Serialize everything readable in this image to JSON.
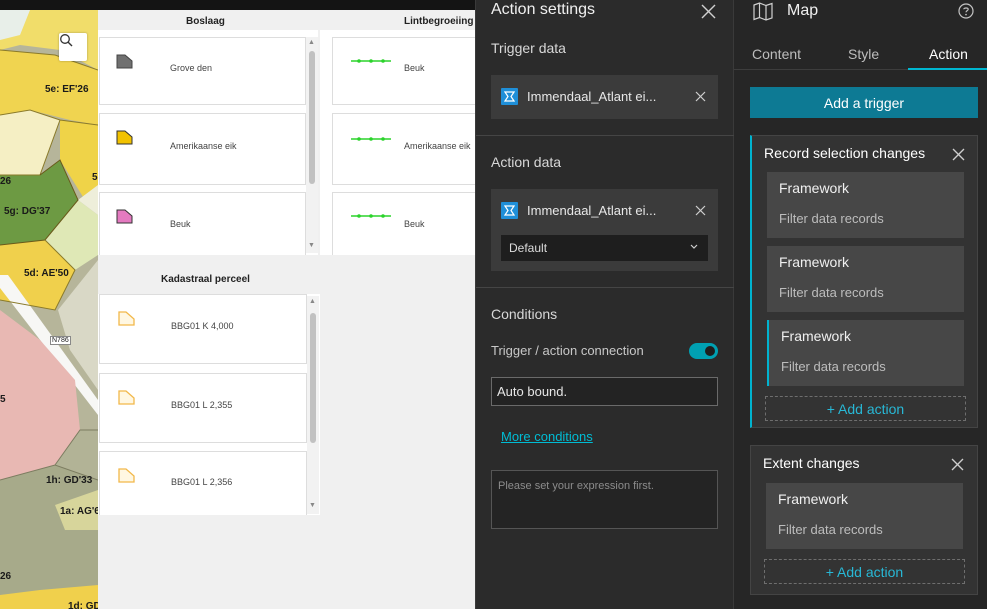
{
  "colors": {
    "accent": "#00a0b2",
    "link": "#00bcd4",
    "primary_button": "#0d7a94",
    "panel_bg": "#2b2b2b",
    "datasource_icon": "#1f8fd8"
  },
  "map": {
    "labels": {
      "zone_5e": "5e: EF'26",
      "zone_26": "26",
      "zone_5": "5",
      "zone_5g": "5g: DG'37",
      "zone_5d": "5d: AE'50",
      "road": "N786",
      "zone_5b": "5",
      "zone_1h": "1h: GD'33",
      "zone_1a": "1a: AG'6",
      "zone_26b": "26",
      "zone_1d": "1d: GD"
    }
  },
  "legend": {
    "groups": [
      {
        "title": "Boslaag",
        "items": [
          {
            "label": "Grove den",
            "color": "#707070"
          },
          {
            "label": "Amerikaanse eik",
            "color": "#f2c200"
          },
          {
            "label": "Beuk",
            "color": "#e47ac0"
          }
        ]
      },
      {
        "title": "Lintbegroeiing",
        "items": [
          {
            "label": "Beuk",
            "color": "#2bd32b"
          },
          {
            "label": "Amerikaanse eik",
            "color": "#2bd32b"
          },
          {
            "label": "Beuk",
            "color": "#2bd32b"
          }
        ]
      },
      {
        "title": "Kadastraal perceel",
        "items": [
          {
            "label": "BBG01 K 4,000",
            "color": "#f2b84a"
          },
          {
            "label": "BBG01 L 2,355",
            "color": "#f2b84a"
          },
          {
            "label": "BBG01 L 2,356",
            "color": "#f2b84a"
          }
        ]
      }
    ]
  },
  "action_settings": {
    "title": "Action settings",
    "trigger_data": {
      "heading": "Trigger data",
      "source": "Immendaal_Atlant ei..."
    },
    "action_data": {
      "heading": "Action data",
      "source": "Immendaal_Atlant ei...",
      "view_select": "Default"
    },
    "conditions": {
      "heading": "Conditions",
      "connection_label": "Trigger / action connection",
      "connection_enabled": true,
      "auto_bound": "Auto bound.",
      "more_link": "More conditions",
      "expression_placeholder": "Please set your expression first."
    }
  },
  "map_panel": {
    "title": "Map",
    "tabs": [
      {
        "label": "Content",
        "active": false
      },
      {
        "label": "Style",
        "active": false
      },
      {
        "label": "Action",
        "active": true
      }
    ],
    "add_trigger_label": "Add a trigger",
    "triggers": [
      {
        "name": "Record selection changes",
        "actions": [
          {
            "name": "Framework",
            "desc": "Filter data records"
          },
          {
            "name": "Framework",
            "desc": "Filter data records"
          },
          {
            "name": "Framework",
            "desc": "Filter data records"
          }
        ],
        "add_action_label": "+ Add action"
      },
      {
        "name": "Extent changes",
        "actions": [
          {
            "name": "Framework",
            "desc": "Filter data records"
          }
        ],
        "add_action_label": "+ Add action"
      }
    ]
  }
}
